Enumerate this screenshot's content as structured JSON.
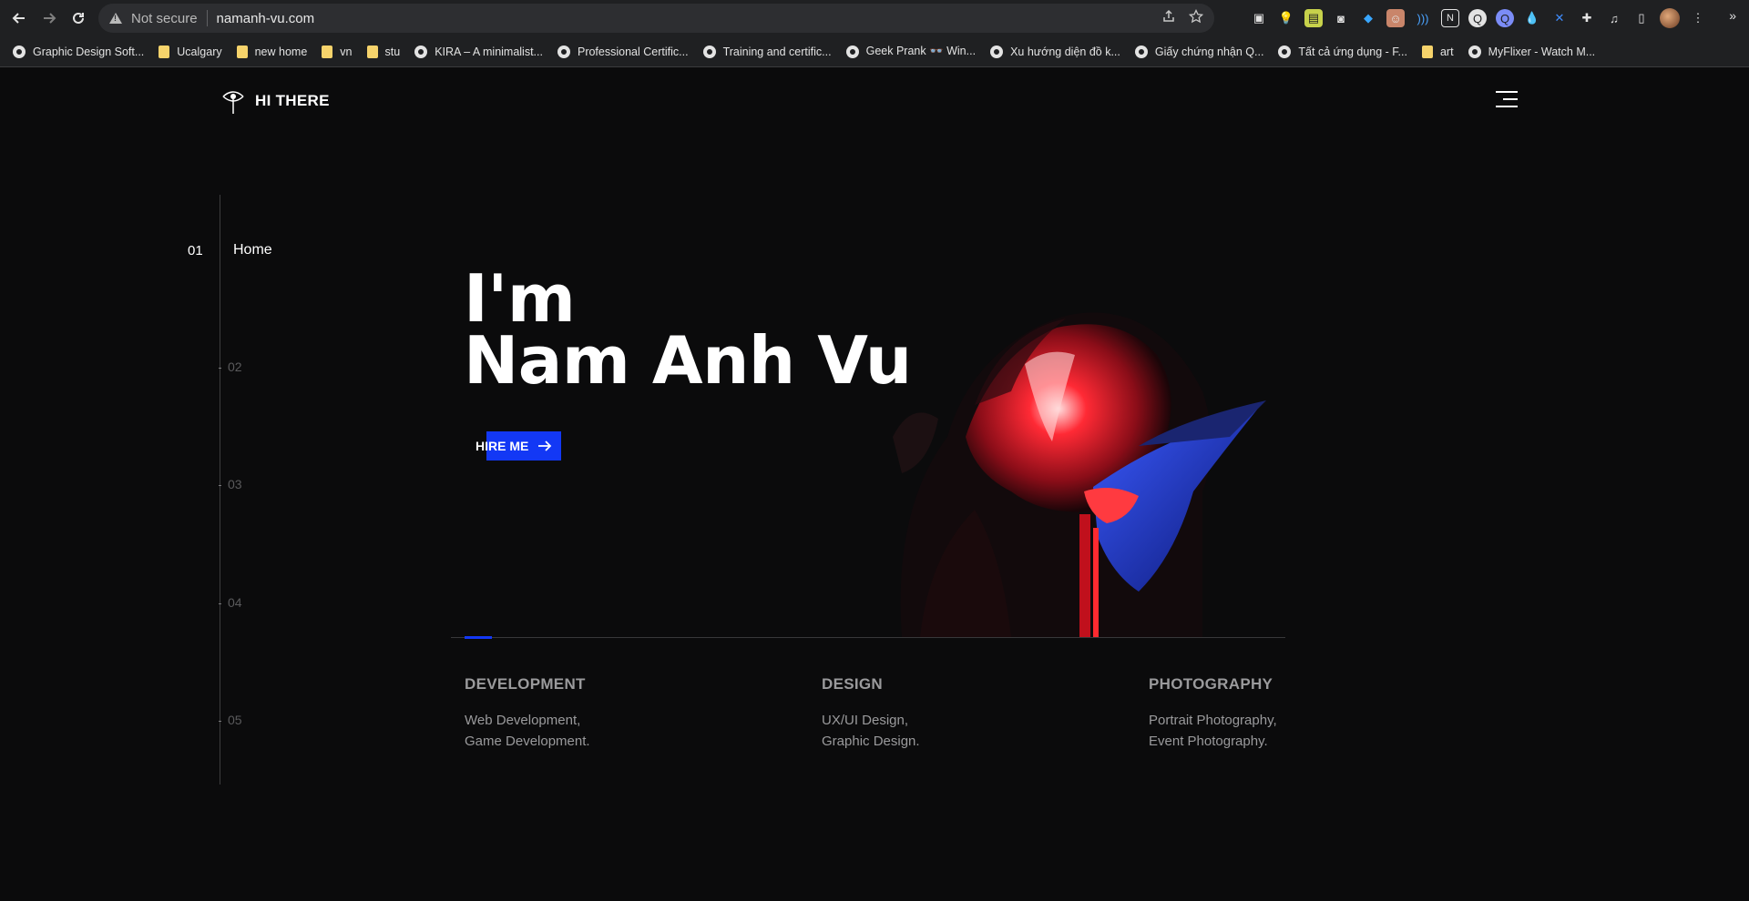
{
  "browser": {
    "back_icon": "arrow-left-icon",
    "forward_icon": "arrow-right-icon",
    "reload_icon": "reload-icon",
    "security_label": "Not secure",
    "url": "namanh-vu.com",
    "bookmarks": [
      {
        "label": "Graphic Design Soft...",
        "icon": "globe"
      },
      {
        "label": "Ucalgary",
        "icon": "folder"
      },
      {
        "label": "new home",
        "icon": "folder"
      },
      {
        "label": "vn",
        "icon": "folder"
      },
      {
        "label": "stu",
        "icon": "folder"
      },
      {
        "label": "KIRA – A minimalist...",
        "icon": "globe"
      },
      {
        "label": "Professional Certific...",
        "icon": "globe"
      },
      {
        "label": "Training and certific...",
        "icon": "globe"
      },
      {
        "label": "Geek Prank 👓 Win...",
        "icon": "globe"
      },
      {
        "label": "Xu hướng diện đồ k...",
        "icon": "globe"
      },
      {
        "label": "Giấy chứng nhận Q...",
        "icon": "globe"
      },
      {
        "label": "Tất cả ứng dụng - F...",
        "icon": "globe"
      },
      {
        "label": "art",
        "icon": "folder"
      },
      {
        "label": "MyFlixer - Watch M...",
        "icon": "globe"
      }
    ],
    "bookmarks_more": "»"
  },
  "header": {
    "logo_text": "HI THERE"
  },
  "sidenav": {
    "items": [
      {
        "num": "01",
        "label": "Home"
      },
      {
        "num": "02"
      },
      {
        "num": "03"
      },
      {
        "num": "04"
      },
      {
        "num": "05"
      }
    ]
  },
  "hero": {
    "line1": "I'm",
    "line2": "Nam Anh Vu",
    "cta": "HIRE ME",
    "progress": 0.04
  },
  "services": [
    {
      "title": "DEVELOPMENT",
      "line1": "Web Development,",
      "line2": "Game Development."
    },
    {
      "title": "DESIGN",
      "line1": "UX/UI Design,",
      "line2": "Graphic Design."
    },
    {
      "title": "PHOTOGRAPHY",
      "line1": "Portrait Photography,",
      "line2": "Event Photography."
    }
  ],
  "colors": {
    "accent": "#1338f5",
    "background": "#0b0b0c"
  }
}
